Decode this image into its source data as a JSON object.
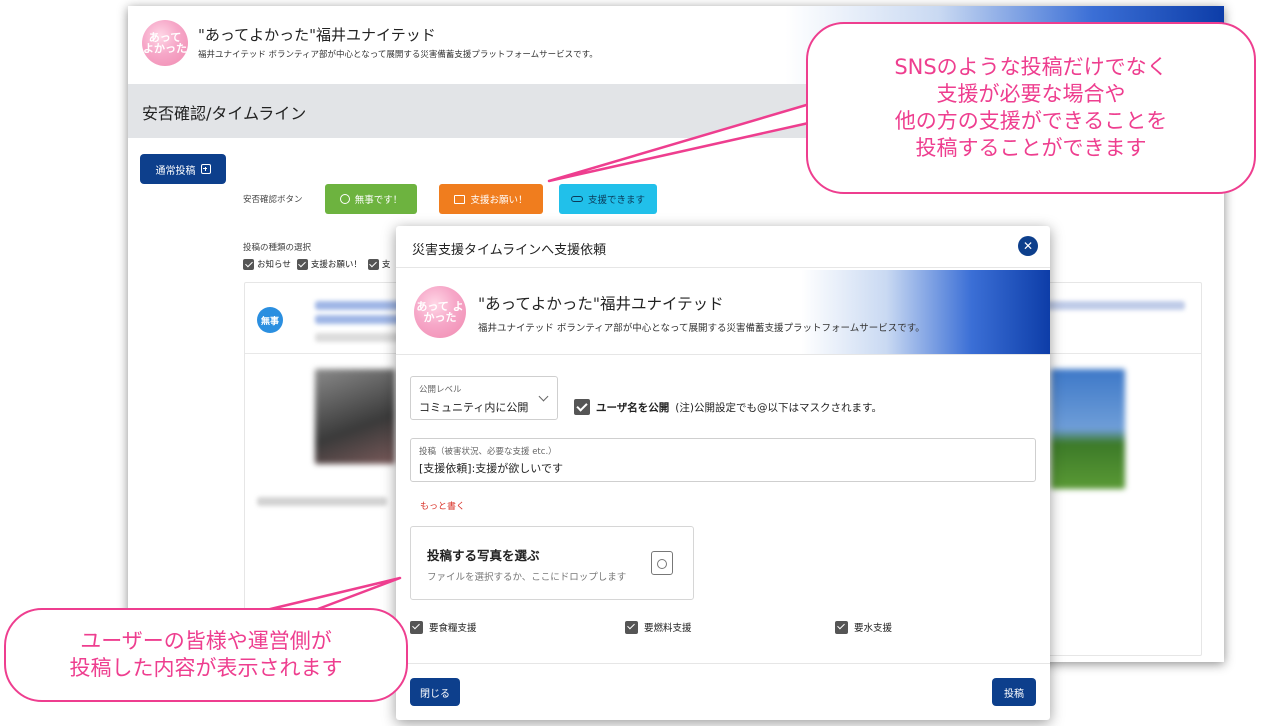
{
  "site": {
    "logo_text": "あって よかった",
    "title": "\"あってよかった\"福井ユナイテッド",
    "subtitle": "福井ユナイテッド ボランティア部が中心となって展開する災害備蓄支援プラットフォームサービスです。"
  },
  "page": {
    "title": "安否確認/タイムライン",
    "normal_post_label": "通常投稿"
  },
  "safety": {
    "label": "安否確認ボタン",
    "ok_label": "無事です！",
    "help_label": "支援お願い！",
    "can_help_label": "支援できます"
  },
  "filters": {
    "label": "投稿の種類の選択",
    "items": [
      "お知らせ",
      "支援お願い！",
      "支"
    ]
  },
  "timeline": {
    "badge": "無事"
  },
  "modal": {
    "title": "災害支援タイムラインへ支援依頼",
    "close_glyph": "✕",
    "visibility": {
      "label": "公開レベル",
      "value": "コミュニティ内に公開"
    },
    "username_public": {
      "label": "ユーザ名を公開",
      "note": "(注)公開設定でも@以下はマスクされます。"
    },
    "post": {
      "label": "投稿（被害状況、必要な支援 etc.）",
      "value": "[支援依頼]:支援が欲しいです"
    },
    "more_link": "もっと書く",
    "photo": {
      "title": "投稿する写真を選ぶ",
      "subtitle": "ファイルを選択するか、ここにドロップします"
    },
    "needs": [
      "要食糧支援",
      "要燃料支援",
      "要水支援"
    ],
    "close_button": "閉じる",
    "post_button": "投稿"
  },
  "callouts": {
    "top": [
      "SNSのような投稿だけでなく",
      "支援が必要な場合や",
      "他の方の支援ができることを",
      "投稿することができます"
    ],
    "bottom": [
      "ユーザーの皆様や運営側が",
      "投稿した内容が表示されます"
    ]
  },
  "colors": {
    "primary": "#0d3f8c",
    "ok_green": "#6db33f",
    "help_orange": "#f07d1e",
    "can_help_cyan": "#21c0ea",
    "callout_pink": "#ee3e8f",
    "link_red": "#d9342b"
  }
}
